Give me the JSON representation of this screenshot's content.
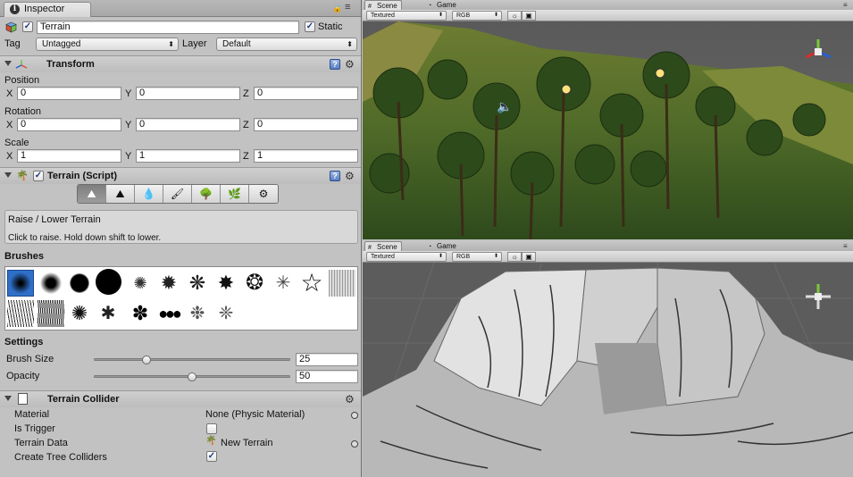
{
  "inspector": {
    "tab_label": "Inspector",
    "object": {
      "name": "Terrain",
      "static_label": "Static",
      "static_checked": true,
      "active_checked": true
    },
    "tag": {
      "label": "Tag",
      "value": "Untagged"
    },
    "layer": {
      "label": "Layer",
      "value": "Default"
    },
    "transform": {
      "title": "Transform",
      "position": {
        "label": "Position",
        "x": "0",
        "y": "0",
        "z": "0"
      },
      "rotation": {
        "label": "Rotation",
        "x": "0",
        "y": "0",
        "z": "0"
      },
      "scale": {
        "label": "Scale",
        "x": "1",
        "y": "1",
        "z": "1"
      },
      "axis_x": "X",
      "axis_y": "Y",
      "axis_z": "Z"
    },
    "terrain_script": {
      "title": "Terrain (Script)",
      "tools": [
        "raise-lower-icon",
        "paint-height-icon",
        "smooth-height-icon",
        "paint-texture-icon",
        "place-trees-icon",
        "paint-details-icon",
        "settings-icon"
      ],
      "selected_tool": 0,
      "tool_name": "Raise / Lower Terrain",
      "tool_help": "Click to raise. Hold down shift to lower.",
      "brushes_label": "Brushes",
      "settings_label": "Settings",
      "brush_size": {
        "label": "Brush Size",
        "value": "25",
        "fraction": 0.27
      },
      "opacity": {
        "label": "Opacity",
        "value": "50",
        "fraction": 0.5
      }
    },
    "terrain_collider": {
      "title": "Terrain Collider",
      "material": {
        "label": "Material",
        "value": "None (Physic Material)"
      },
      "is_trigger": {
        "label": "Is Trigger",
        "checked": false
      },
      "terrain_data": {
        "label": "Terrain Data",
        "value": "New Terrain"
      },
      "create_tree_colliders": {
        "label": "Create Tree Colliders",
        "checked": true
      }
    }
  },
  "scene_top": {
    "tabs": [
      "Scene",
      "Game"
    ],
    "active_tab": "Scene",
    "render_mode": "Textured",
    "color_mode": "RGB"
  },
  "scene_bottom": {
    "tabs": [
      "Scene",
      "Game"
    ],
    "active_tab": "Scene",
    "render_mode": "Textured",
    "color_mode": "RGB"
  },
  "colors": {
    "panel_bg": "#c2c2c2",
    "selection_blue": "#2f6fc8",
    "gizmo_x": "#d23030",
    "gizmo_y": "#7ac63a",
    "gizmo_z": "#2a5fd0"
  }
}
